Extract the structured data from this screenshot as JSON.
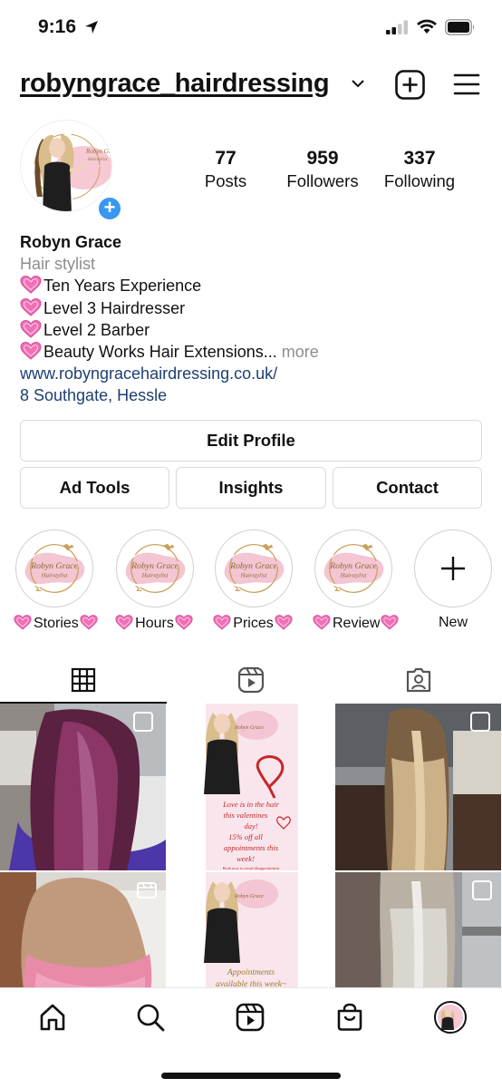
{
  "status_bar": {
    "time": "9:16"
  },
  "header": {
    "username": "robyngrace_hairdressing"
  },
  "stats": [
    {
      "value": "77",
      "label": "Posts"
    },
    {
      "value": "959",
      "label": "Followers"
    },
    {
      "value": "337",
      "label": "Following"
    }
  ],
  "bio": {
    "name": "Robyn Grace",
    "category": "Hair stylist",
    "lines": [
      "Ten Years Experience",
      "Level 3 Hairdresser",
      "Level 2 Barber",
      "Beauty Works Hair Extensions..."
    ],
    "more": "more",
    "website": "www.robyngracehairdressing.co.uk/",
    "location": "8 Southgate, Hessle"
  },
  "buttons": {
    "edit_profile": "Edit Profile",
    "ad_tools": "Ad Tools",
    "insights": "Insights",
    "contact": "Contact"
  },
  "highlights": [
    {
      "label": "Stories"
    },
    {
      "label": "Hours"
    },
    {
      "label": "Prices"
    },
    {
      "label": "Review"
    }
  ],
  "new_highlight": "New",
  "logo_text": {
    "line1": "Robyn Grace",
    "line2": "Hairstylist"
  },
  "posts": {
    "valentine_text": [
      "Love is in the hair",
      "this valentines",
      "day!",
      "15% off all",
      "appointments this",
      "week!"
    ],
    "valentine_small": "Book now to avoid disappointment",
    "appointments_text": [
      "Appointments",
      "available this week~"
    ]
  },
  "colors": {
    "accent": "#3897f0",
    "link": "#1d3f72",
    "muted": "#8e8e8e",
    "border": "#dbdbdb"
  }
}
